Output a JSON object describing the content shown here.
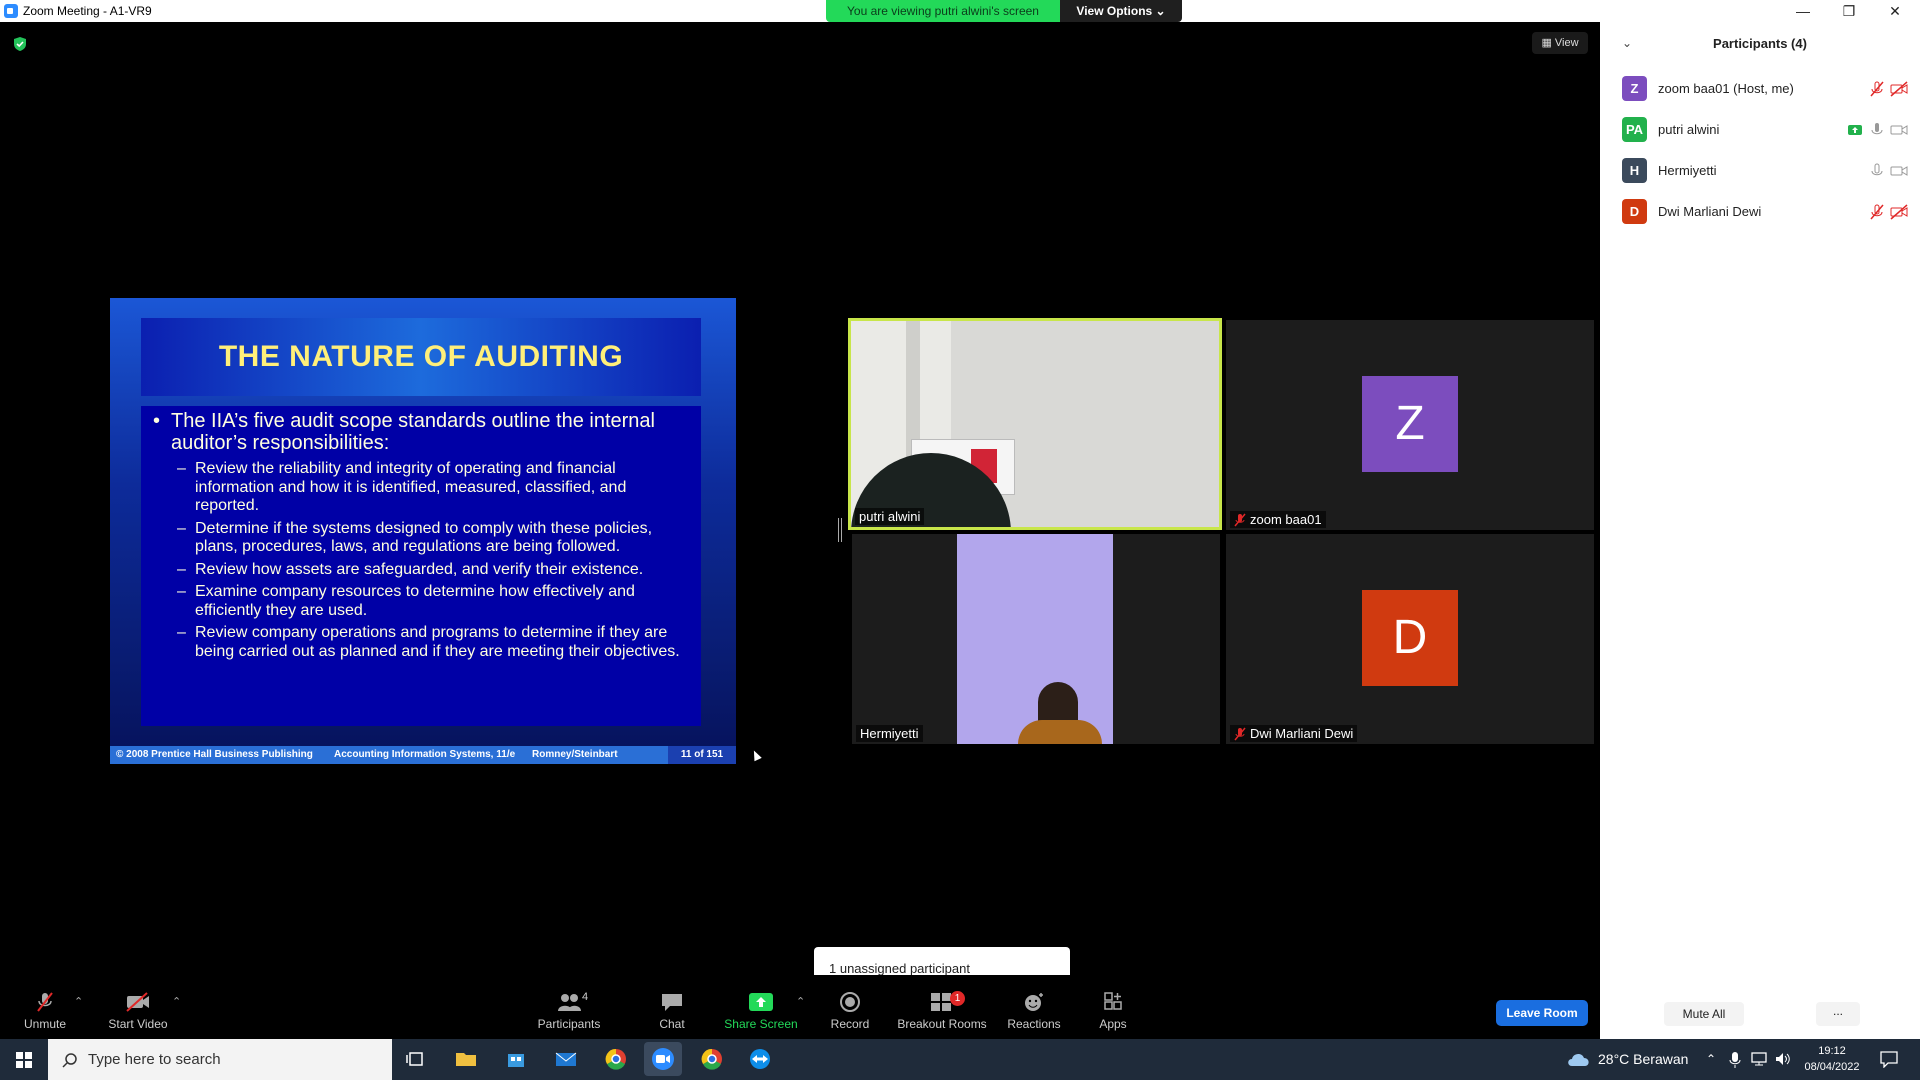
{
  "window": {
    "title": "Zoom Meeting - A1-VR9",
    "minimize": "—",
    "restore": "❐",
    "close": "✕"
  },
  "banner": {
    "viewing": "You are viewing putri alwini's screen",
    "view_options": "View Options ⌄"
  },
  "view_button": "View",
  "slide": {
    "title": "THE NATURE OF AUDITING",
    "bullet": "The IIA’s five audit scope standards outline the internal auditor’s responsibilities:",
    "items": [
      "Review the reliability and integrity of operating and financial information and how it is identified, measured, classified, and reported.",
      "Determine if the systems designed to comply with these policies, plans, procedures, laws, and regulations are being followed.",
      "Review how assets are safeguarded, and verify their existence.",
      "Examine company resources to determine how effectively and efficiently they are used.",
      "Review company operations and programs to determine if they are being carried out as planned and if they are meeting their objectives."
    ],
    "footer": {
      "copyright": "© 2008 Prentice Hall Business Publishing",
      "book": "Accounting Information Systems, 11/e",
      "authors": "Romney/Steinbart",
      "page": "11 of 151"
    }
  },
  "tiles": [
    {
      "name": "putri alwini"
    },
    {
      "name": "zoom baa01",
      "initial": "Z",
      "color": "#7c4dbe"
    },
    {
      "name": "Hermiyetti"
    },
    {
      "name": "Dwi Marliani Dewi",
      "initial": "D",
      "color": "#d03a10"
    }
  ],
  "participants": {
    "title": "Participants (4)",
    "list": [
      {
        "initials": "Z",
        "name": "zoom baa01 (Host, me)",
        "color": "#7c4dbe"
      },
      {
        "initials": "PA",
        "name": "putri alwini",
        "color": "#22b14c"
      },
      {
        "initials": "H",
        "name": "Hermiyetti",
        "color": "#3b4a5c"
      },
      {
        "initials": "D",
        "name": "Dwi Marliani Dewi",
        "color": "#d03a10"
      }
    ],
    "mute_all": "Mute All",
    "more": "..."
  },
  "toast": "1 unassigned participant",
  "toolbar": {
    "unmute": "Unmute",
    "start_video": "Start Video",
    "participants": "Participants",
    "participants_count": "4",
    "chat": "Chat",
    "share_screen": "Share Screen",
    "record": "Record",
    "breakout_rooms": "Breakout Rooms",
    "breakout_badge": "1",
    "reactions": "Reactions",
    "apps": "Apps",
    "leave": "Leave Room"
  },
  "taskbar": {
    "search_placeholder": "Type here to search",
    "weather": "28°C  Berawan",
    "time": "19:12",
    "date": "08/04/2022"
  }
}
